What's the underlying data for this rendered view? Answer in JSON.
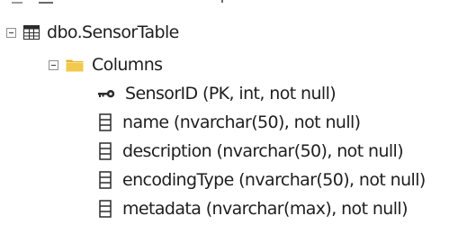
{
  "object_explorer": {
    "table": {
      "label": "dbo.SensorTable",
      "expander_icon": "collapse-minus-icon",
      "icon": "table-grid-icon"
    },
    "columns_folder": {
      "label": "Columns",
      "expander_icon": "collapse-minus-icon",
      "icon": "folder-icon",
      "folder_color": "#f2c94c"
    },
    "columns": [
      {
        "label": "SensorID (PK, int, not null)",
        "icon": "primary-key-icon"
      },
      {
        "label": "name (nvarchar(50), not null)",
        "icon": "column-icon"
      },
      {
        "label": "description (nvarchar(50), not null)",
        "icon": "column-icon"
      },
      {
        "label": "encodingType (nvarchar(50), not null)",
        "icon": "column-icon"
      },
      {
        "label": "metadata (nvarchar(max), not null)",
        "icon": "column-icon"
      }
    ]
  }
}
